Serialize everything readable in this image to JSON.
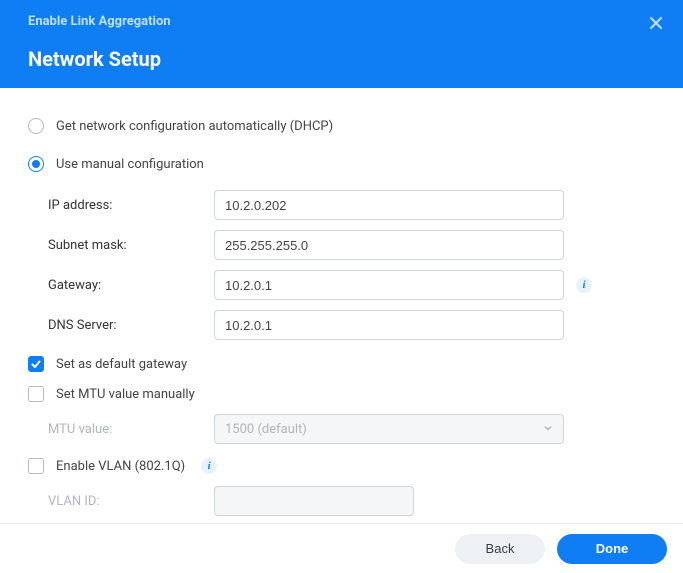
{
  "header": {
    "wizard_title": "Enable Link Aggregation",
    "page_title": "Network Setup"
  },
  "config_mode": {
    "dhcp_label": "Get network configuration automatically (DHCP)",
    "manual_label": "Use manual configuration",
    "selected": "manual"
  },
  "fields": {
    "ip_label": "IP address:",
    "ip_value": "10.2.0.202",
    "subnet_label": "Subnet mask:",
    "subnet_value": "255.255.255.0",
    "gateway_label": "Gateway:",
    "gateway_value": "10.2.0.1",
    "dns_label": "DNS Server:",
    "dns_value": "10.2.0.1"
  },
  "options": {
    "default_gw_label": "Set as default gateway",
    "default_gw_checked": true,
    "mtu_manual_label": "Set MTU value manually",
    "mtu_manual_checked": false,
    "mtu_value_label": "MTU value:",
    "mtu_value_display": "1500 (default)",
    "vlan_enable_label": "Enable VLAN (802.1Q)",
    "vlan_enable_checked": false,
    "vlan_id_label": "VLAN ID:",
    "vlan_id_value": ""
  },
  "footer": {
    "back_label": "Back",
    "done_label": "Done"
  },
  "info_glyph": "i"
}
